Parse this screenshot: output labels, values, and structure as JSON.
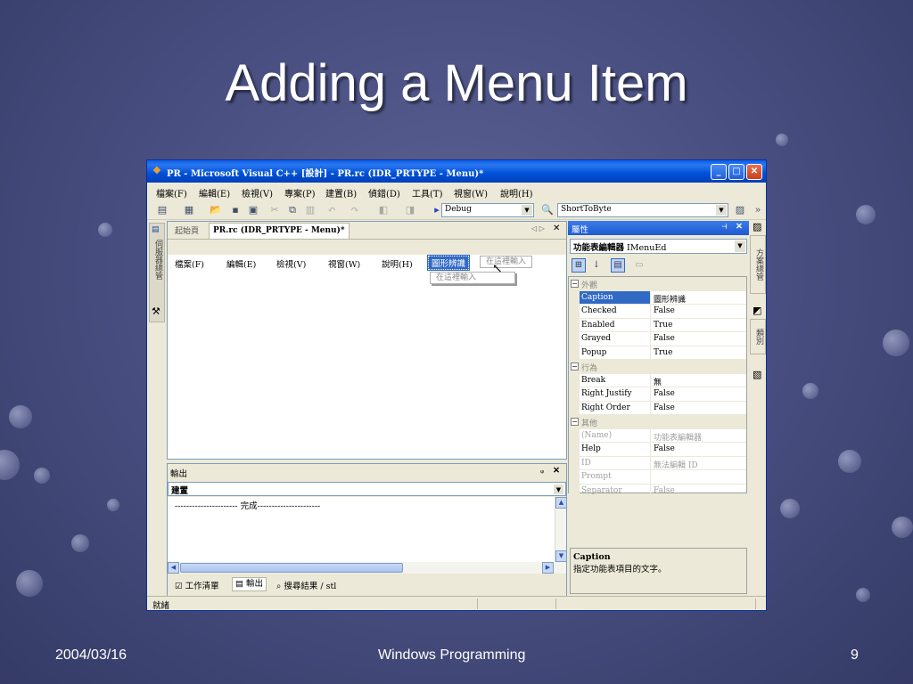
{
  "slide": {
    "title": "Adding a Menu Item",
    "date": "2004/03/16",
    "course": "Windows Programming",
    "page": "9"
  },
  "window": {
    "title": "PR - Microsoft Visual C++ [設計] - PR.rc (IDR_PRTYPE - Menu)*",
    "app_icon": "vc-app-icon",
    "buttons": {
      "minimize": "_",
      "maximize": "□",
      "close": "✕"
    }
  },
  "menubar": [
    "檔案(F)",
    "編輯(E)",
    "檢視(V)",
    "專案(P)",
    "建置(B)",
    "偵錯(D)",
    "工具(T)",
    "視窗(W)",
    "說明(H)"
  ],
  "toolbar": {
    "config": "Debug",
    "solution_function": "ShortToByte"
  },
  "editor": {
    "tab_start": "起始頁",
    "tab_active": "PR.rc (IDR_PRTYPE - Menu)*",
    "menu_items": [
      "檔案(F)",
      "編輯(E)",
      "檢視(V)",
      "視窗(W)",
      "說明(H)"
    ],
    "selected_item": "圖形辨識",
    "type_here": "在這裡輸入",
    "type_here_sub": "在這裡輸入"
  },
  "output": {
    "title": "輸出",
    "pin": "ᵩ",
    "close": "✕",
    "source": "建置",
    "line": "---------------------- 完成----------------------",
    "tabs": [
      "工作清單",
      "輸出",
      "搜尋結果 / stl"
    ]
  },
  "properties": {
    "title": "屬性",
    "object_bold": "功能表編輯器",
    "object_name": "IMenuEd",
    "categories": {
      "appearance": "外觀",
      "behavior": "行為",
      "misc": "其他"
    },
    "appearance_rows": [
      {
        "name": "Caption",
        "value": "圖形辨識"
      },
      {
        "name": "Checked",
        "value": "False"
      },
      {
        "name": "Enabled",
        "value": "True"
      },
      {
        "name": "Grayed",
        "value": "False"
      },
      {
        "name": "Popup",
        "value": "True"
      }
    ],
    "behavior_rows": [
      {
        "name": "Break",
        "value": "無"
      },
      {
        "name": "Right Justify",
        "value": "False"
      },
      {
        "name": "Right Order",
        "value": "False"
      }
    ],
    "misc_rows": [
      {
        "name": "(Name)",
        "value": "功能表編輯器"
      },
      {
        "name": "Help",
        "value": "False"
      },
      {
        "name": "ID",
        "value": "無法編輯 ID"
      },
      {
        "name": "Prompt",
        "value": ""
      },
      {
        "name": "Separator",
        "value": "False"
      }
    ],
    "desc_title": "Caption",
    "desc_text": "指定功能表項目的文字。"
  },
  "side_tabs": {
    "left": "伺服器總管",
    "right_1": "方案總管",
    "right_2": "類別"
  },
  "status": {
    "text": "就緒"
  }
}
